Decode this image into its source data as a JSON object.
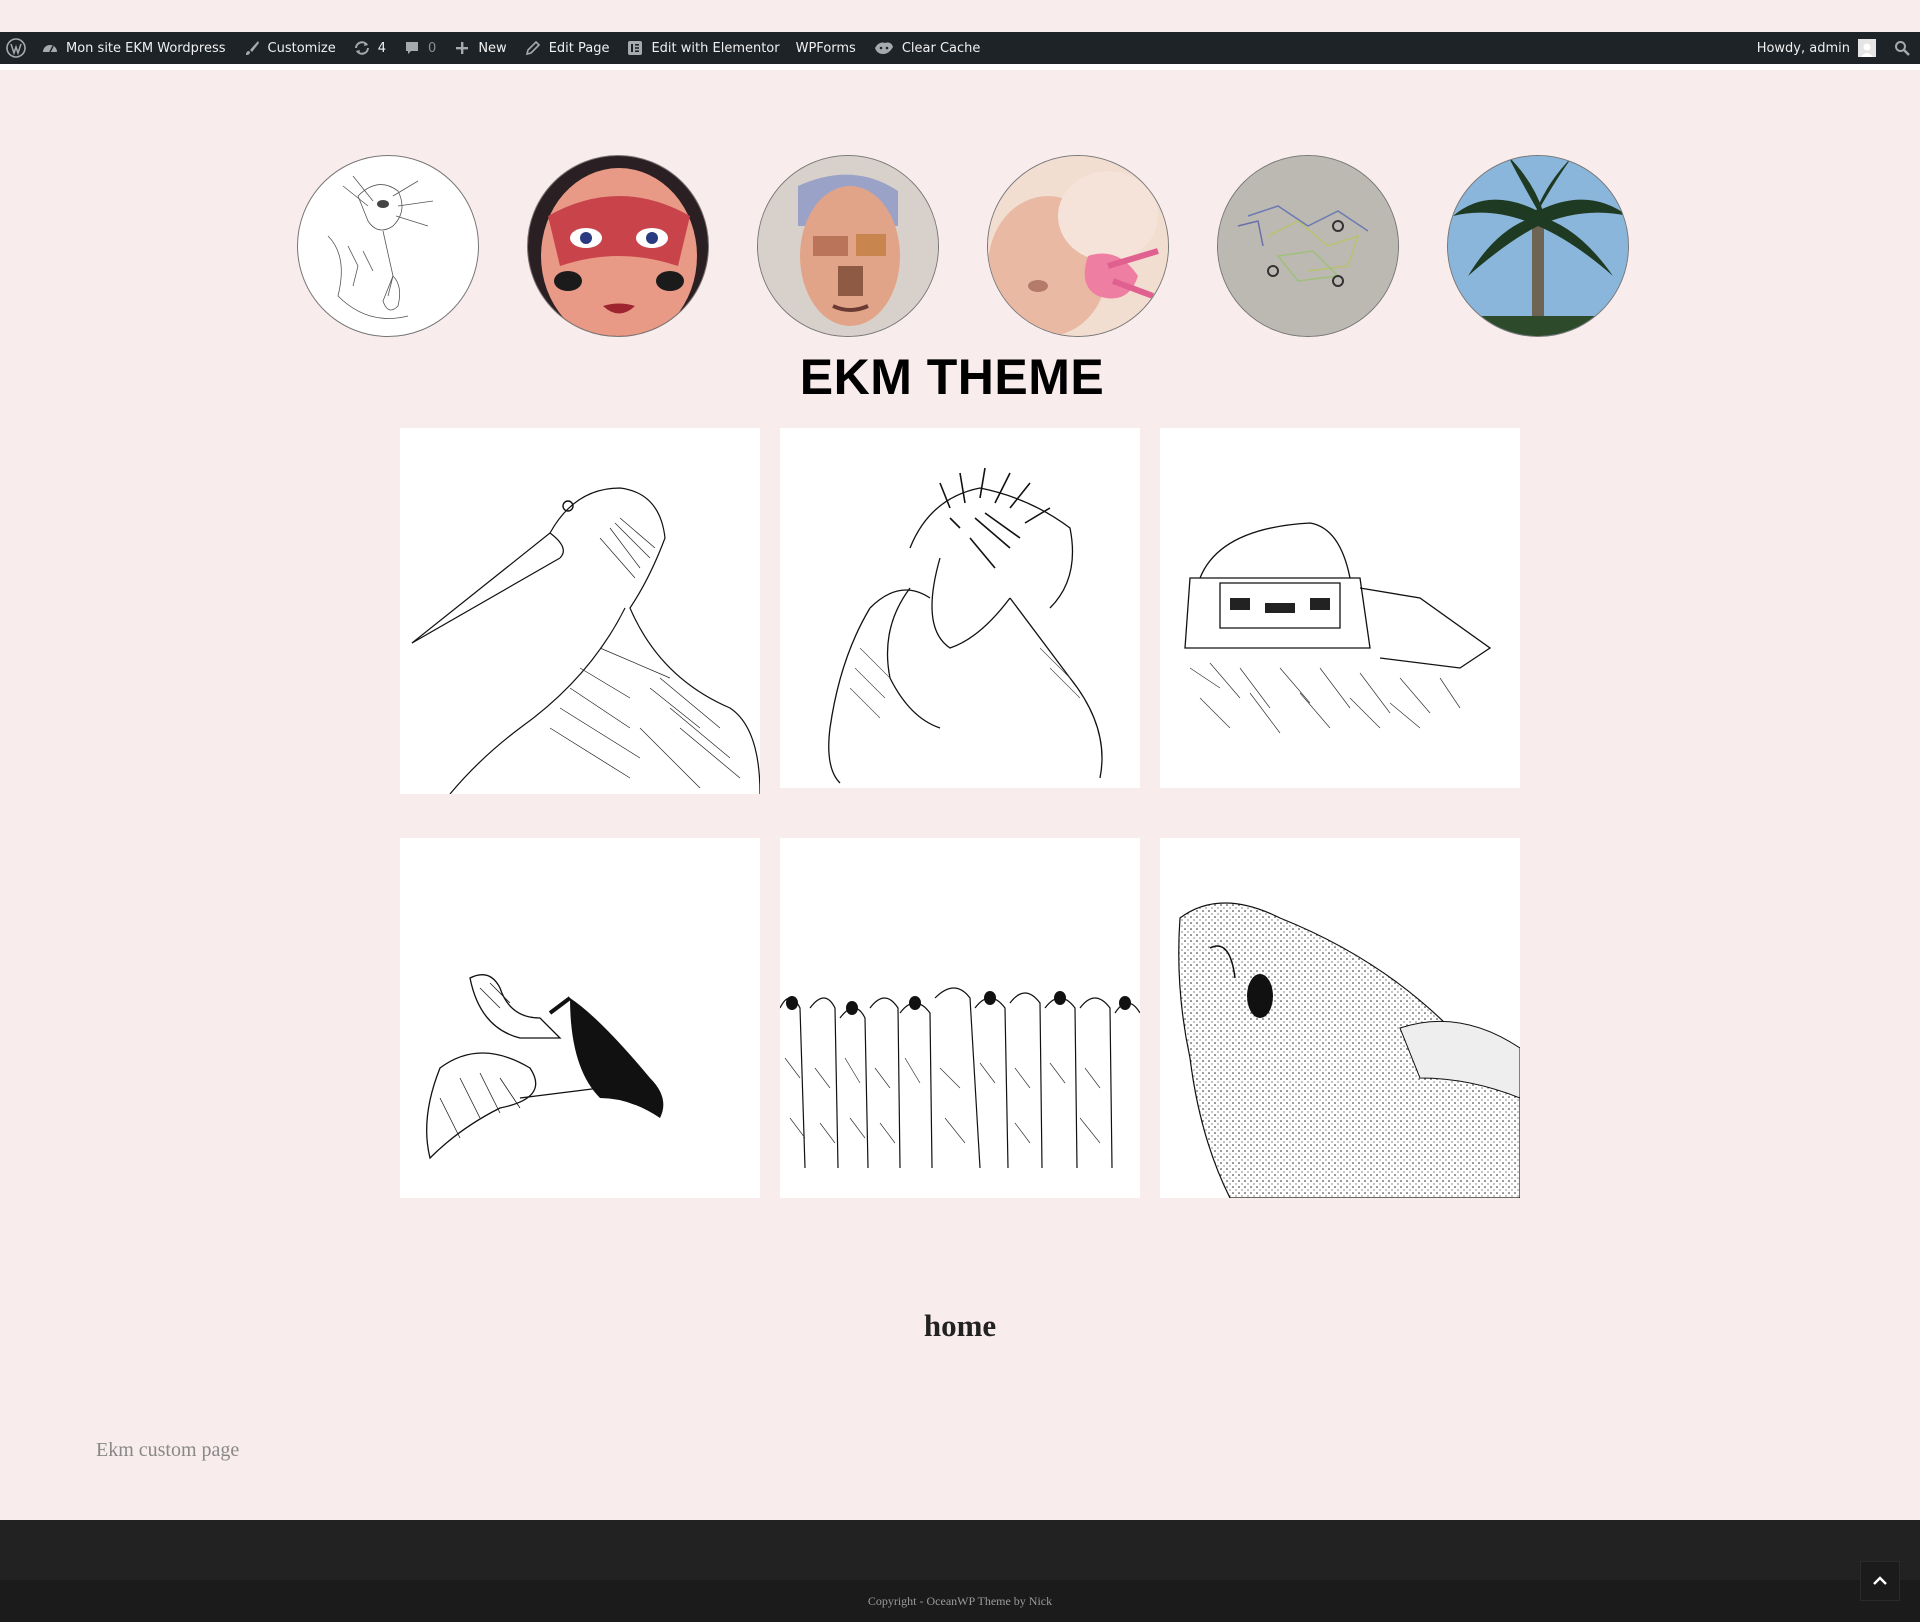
{
  "admin_bar": {
    "wp_logo_icon": "wordpress-icon",
    "site_name": "Mon site EKM Wordpress",
    "customize": "Customize",
    "updates_count": "4",
    "comments_count": "0",
    "new": "New",
    "edit_page": "Edit Page",
    "edit_elementor": "Edit with Elementor",
    "wpforms": "WPForms",
    "clear_cache": "Clear Cache",
    "howdy": "Howdy, admin"
  },
  "circles": [
    {
      "label": "sketch-bird-thumb"
    },
    {
      "label": "mask-face-thumb"
    },
    {
      "label": "painted-face-thumb"
    },
    {
      "label": "pink-clay-thumb"
    },
    {
      "label": "embroidery-thumb"
    },
    {
      "label": "palm-tree-thumb"
    }
  ],
  "site_title": "EKM THEME",
  "gallery": [
    {
      "label": "heron-drawing"
    },
    {
      "label": "figure-drawing"
    },
    {
      "label": "car-wreck-drawing"
    },
    {
      "label": "birds-drawing"
    },
    {
      "label": "crowd-drawing"
    },
    {
      "label": "fish-drawing"
    }
  ],
  "page_title": "home",
  "custom_page_text": "Ekm custom page",
  "footer": {
    "copyright": "Copyright - OceanWP Theme by Nick"
  },
  "colors": {
    "background": "#f9ecec",
    "admin_bar": "#1d2327",
    "footer": "#222222"
  }
}
